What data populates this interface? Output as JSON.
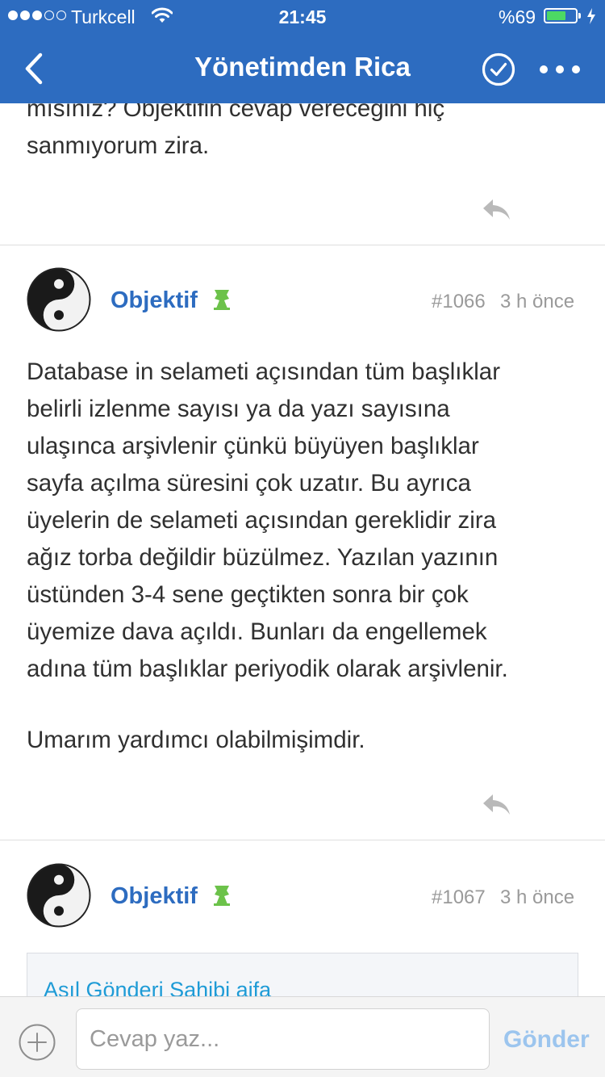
{
  "status_bar": {
    "carrier": "Turkcell",
    "time": "21:45",
    "battery_percent": "%69",
    "battery_level": 0.69,
    "signal_bars": 3,
    "signal_total": 5
  },
  "nav": {
    "title": "Yönetimden Rica",
    "back_icon": "chevron-left-icon",
    "check_icon": "check-circle-icon",
    "more_icon": "more-horizontal-icon"
  },
  "posts": [
    {
      "partial_lines": [
        "mısınız? Objektifin cevap vereceğini hiç",
        "sanmıyorum zira."
      ]
    },
    {
      "author": "Objektif",
      "post_number": "#1066",
      "time_ago": "3 h önce",
      "body_lines": [
        "Database in selameti açısından tüm başlıklar",
        "belirli izlenme sayısı ya da yazı sayısına",
        "ulaşınca arşivlenir çünkü büyüyen başlıklar",
        "sayfa açılma süresini çok uzatır. Bu ayrıca",
        "üyelerin de selameti açısından gereklidir zira",
        "ağız torba değildir büzülmez. Yazılan yazının",
        "üstünden 3-4 sene geçtikten sonra bir çok",
        "üyemize dava açıldı. Bunları da engellemek",
        "adına tüm başlıklar periyodik olarak arşivlenir."
      ],
      "closing": "Umarım yardımcı olabilmişimdir."
    },
    {
      "author": "Objektif",
      "post_number": "#1067",
      "time_ago": "3 h önce",
      "quote_header": "Asıl Gönderi Sahibi aifa"
    }
  ],
  "reply_bar": {
    "placeholder": "Cevap yaz...",
    "send_label": "Gönder"
  },
  "colors": {
    "brand_blue": "#2d6cc0",
    "link_cyan": "#1e9bd6",
    "moderator_badge_green": "#6cc24a",
    "send_disabled": "#9cc5ee"
  }
}
